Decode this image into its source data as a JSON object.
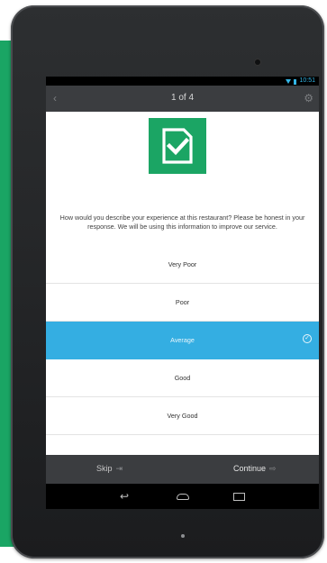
{
  "status_bar": {
    "time": "10:51"
  },
  "header": {
    "counter": "1 of 4"
  },
  "question": "How would you describe your experience at this restaurant? Please be honest in your response. We will be using this information to improve our service.",
  "options": [
    {
      "label": "Very Poor"
    },
    {
      "label": "Poor"
    },
    {
      "label": "Average"
    },
    {
      "label": "Good"
    },
    {
      "label": "Very Good"
    }
  ],
  "selected_option": "Average",
  "footer": {
    "skip_label": "Skip",
    "continue_label": "Continue"
  },
  "icons": {
    "back": "back-icon",
    "settings": "gear-icon",
    "logo": "document-checkmark-icon",
    "selected": "check-circle-icon",
    "skip": "skip-arrow-icon",
    "continue": "continue-arrow-icon",
    "nav_back": "nav-back-icon",
    "nav_home": "nav-home-icon",
    "nav_recent": "nav-recent-apps-icon"
  },
  "colors": {
    "accent": "#34aee2",
    "brand_green": "#1ba564",
    "bar": "#3b3d40"
  }
}
